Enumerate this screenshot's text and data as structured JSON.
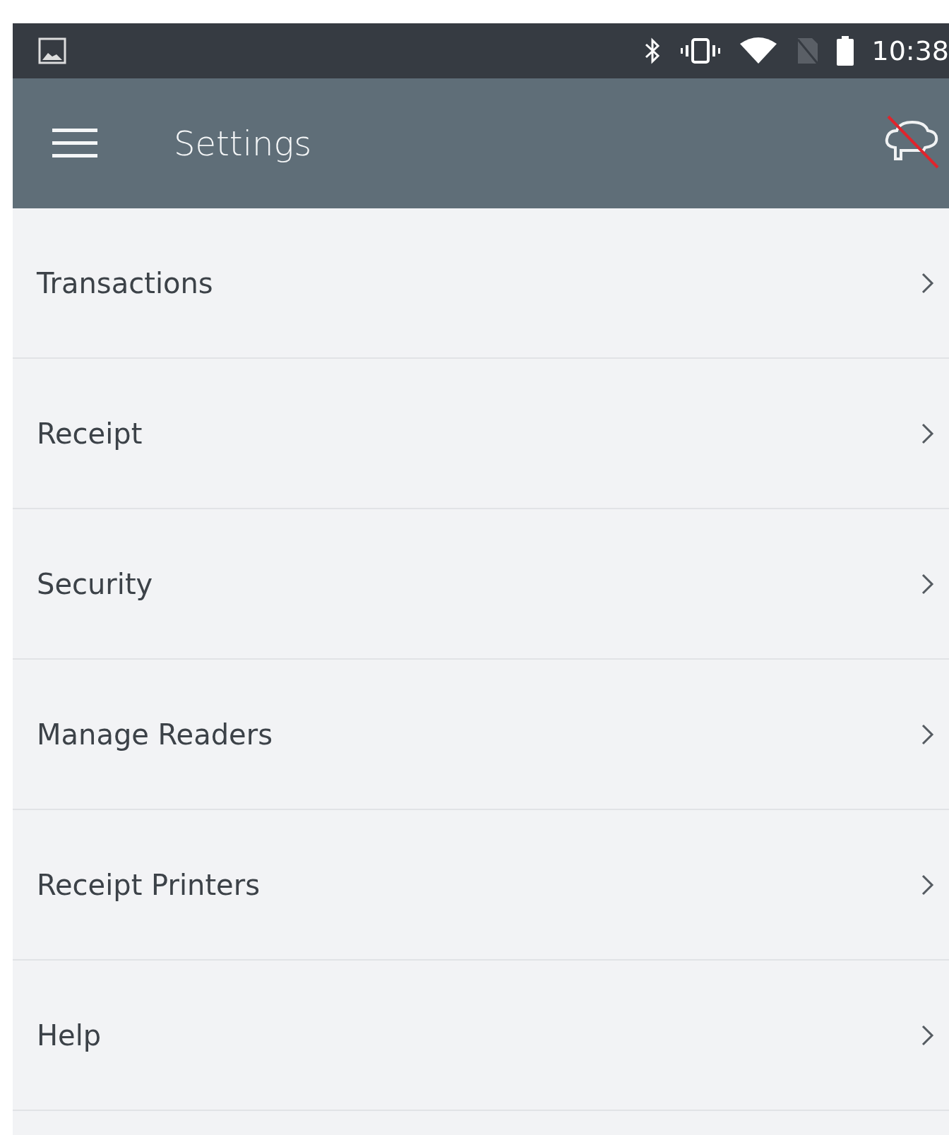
{
  "status_bar": {
    "time": "10:38"
  },
  "app_bar": {
    "title": "Settings",
    "reader_connected": false
  },
  "items": [
    {
      "label": "Transactions"
    },
    {
      "label": "Receipt"
    },
    {
      "label": "Security"
    },
    {
      "label": "Manage Readers"
    },
    {
      "label": "Receipt Printers"
    },
    {
      "label": "Help"
    }
  ]
}
